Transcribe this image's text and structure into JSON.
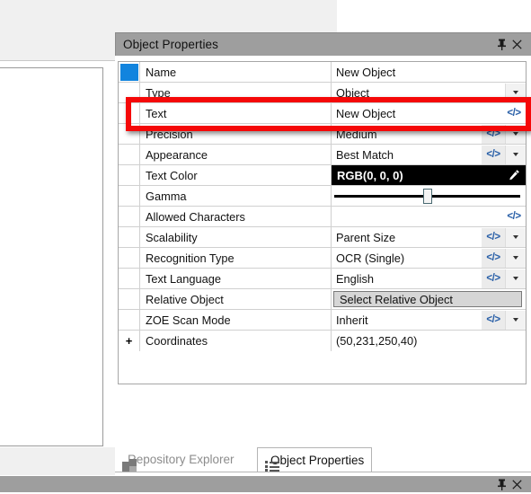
{
  "panel": {
    "title": "Object Properties",
    "pin_icon": "pin-icon",
    "close_icon": "close-icon",
    "pin_glyph": "⍰",
    "close_glyph": "✕"
  },
  "grid": {
    "rows": [
      {
        "marker": "swatch",
        "label": "Name",
        "value": "New Object",
        "code": false,
        "dropdown": false,
        "kind": "text"
      },
      {
        "marker": "",
        "label": "Type",
        "value": "Object",
        "code": false,
        "dropdown": true,
        "kind": "text"
      },
      {
        "marker": "",
        "label": "Text",
        "value": "New Object",
        "code": true,
        "dropdown": false,
        "kind": "text"
      },
      {
        "marker": "",
        "label": "Precision",
        "value": "Medium",
        "code": true,
        "dropdown": true,
        "kind": "text"
      },
      {
        "marker": "",
        "label": "Appearance",
        "value": "Best Match",
        "code": true,
        "dropdown": true,
        "kind": "text"
      },
      {
        "marker": "",
        "label": "Text Color",
        "value": "RGB(0, 0, 0)",
        "code": false,
        "dropdown": false,
        "kind": "color"
      },
      {
        "marker": "",
        "label": "Gamma",
        "value": "",
        "code": false,
        "dropdown": false,
        "kind": "slider"
      },
      {
        "marker": "",
        "label": "Allowed Characters",
        "value": "",
        "code": true,
        "dropdown": false,
        "kind": "text"
      },
      {
        "marker": "",
        "label": "Scalability",
        "value": "Parent Size",
        "code": true,
        "dropdown": true,
        "kind": "text"
      },
      {
        "marker": "",
        "label": "Recognition Type",
        "value": "OCR (Single)",
        "code": true,
        "dropdown": true,
        "kind": "text"
      },
      {
        "marker": "",
        "label": "Text Language",
        "value": "English",
        "code": true,
        "dropdown": true,
        "kind": "text"
      },
      {
        "marker": "",
        "label": "Relative Object",
        "value": "Select Relative Object",
        "code": false,
        "dropdown": false,
        "kind": "button"
      },
      {
        "marker": "",
        "label": "ZOE Scan Mode",
        "value": "Inherit",
        "code": true,
        "dropdown": true,
        "kind": "text"
      },
      {
        "marker": "plus",
        "label": "Coordinates",
        "value": "(50,231,250,40)",
        "code": false,
        "dropdown": false,
        "kind": "text"
      }
    ],
    "code_glyph": "</>",
    "eyedropper_glyph": "✎",
    "plus_glyph": "+",
    "gamma_thumb_percent": 50,
    "swatch_color": "#1284de",
    "color_swatch_value": "#000000",
    "code_icon_color": "#2a60a8"
  },
  "highlight": {
    "name": "text-row-highlight",
    "color": "#f50808",
    "target_row_label": "Text"
  },
  "tabs": [
    {
      "label": "Repository Explorer",
      "icon": "repository-icon",
      "active": false
    },
    {
      "label": "Object Properties",
      "icon": "properties-icon",
      "active": true
    }
  ],
  "statusbar": {
    "pin_glyph": "⍰",
    "close_glyph": "✕"
  }
}
